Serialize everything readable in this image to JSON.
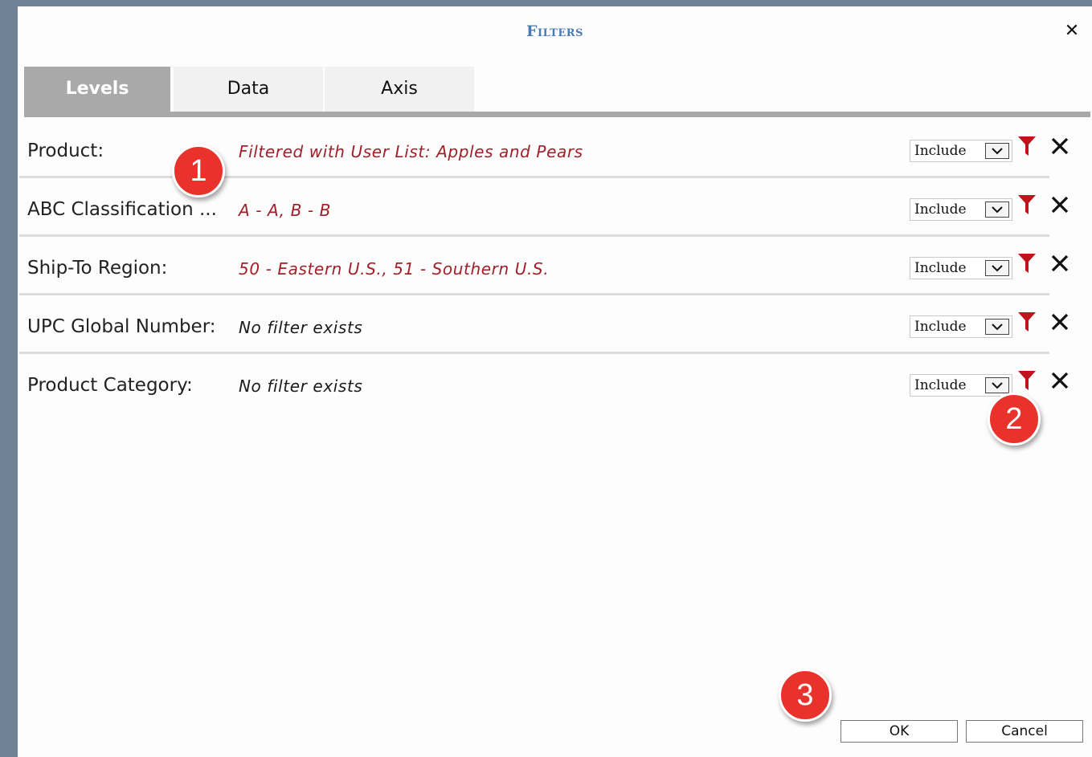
{
  "dialog": {
    "title": "Filters",
    "close_glyph": "✕"
  },
  "tabs": [
    {
      "label": "Levels",
      "active": true
    },
    {
      "label": "Data",
      "active": false
    },
    {
      "label": "Axis",
      "active": false
    }
  ],
  "rows": [
    {
      "label": "Product:",
      "value": "Filtered with User List: Apples and Pears",
      "value_color": "#a0202a",
      "mode": "Include"
    },
    {
      "label": "ABC Classification ...",
      "value": "A - A, B - B",
      "value_color": "#a0202a",
      "mode": "Include"
    },
    {
      "label": "Ship-To Region:",
      "value": "50 - Eastern U.S., 51 - Southern U.S.",
      "value_color": "#a0202a",
      "mode": "Include"
    },
    {
      "label": "UPC Global Number:",
      "value": "No filter exists",
      "value_color": "#1a1a1a",
      "mode": "Include"
    },
    {
      "label": "Product Category:",
      "value": "No filter exists",
      "value_color": "#1a1a1a",
      "mode": "Include"
    }
  ],
  "icons": {
    "filter": "funnel-icon",
    "remove": "close-icon",
    "dropdown": "chevron-down-icon"
  },
  "callouts": [
    "1",
    "2",
    "3"
  ],
  "buttons": {
    "ok": "OK",
    "cancel": "Cancel"
  },
  "colors": {
    "accent_title": "#4a7ab5",
    "filter_icon": "#c0141c",
    "callout": "#e8322b",
    "active_tab": "#a9a9a9"
  }
}
